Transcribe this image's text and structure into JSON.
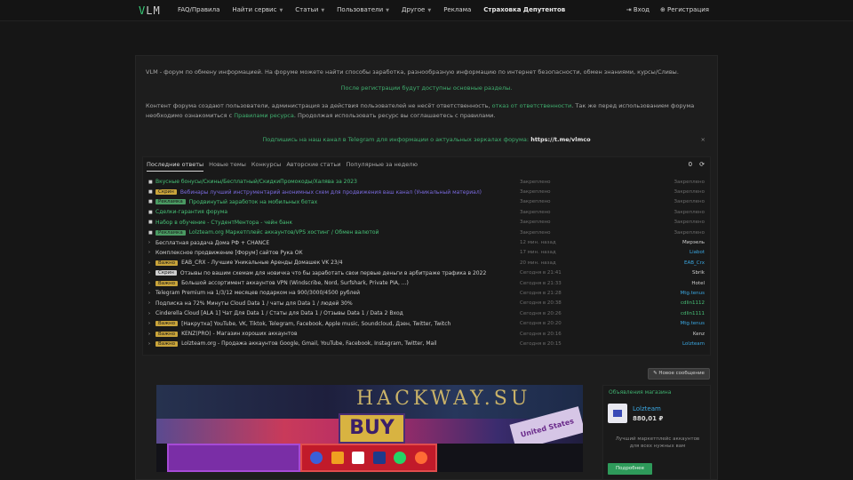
{
  "header": {
    "logo": "VLM",
    "nav": [
      {
        "label": "FAQ/Правила",
        "caret": false
      },
      {
        "label": "Найти сервис",
        "caret": true
      },
      {
        "label": "Статьи",
        "caret": true
      },
      {
        "label": "Пользователи",
        "caret": true
      },
      {
        "label": "Другое",
        "caret": true
      },
      {
        "label": "Реклама",
        "caret": false
      },
      {
        "label": "Страховка Депутентов",
        "caret": false
      }
    ],
    "login": "Вход",
    "register": "Регистрация"
  },
  "intro": {
    "text": "VLM - форум по обмену информацией. На форуме можете найти способы заработка, разнообразную информацию по интернет безопасности, обмен знаниями, курсы/Сливы.",
    "registration_note": "После регистрации будут доступны основные разделы.",
    "text2_a": "Контент форума создают пользователи, администрация за действия пользователей не несёт ответственность,",
    "text2_link": "отказ от ответственности",
    "text2_b": ". Так же перед использованием форума необходимо ознакомиться с",
    "text2_rules": "Правилами ресурса",
    "text2_c": ". Продолжая использовать ресурс вы соглашаетесь с правилами.",
    "telegram_text": "Подпишись на наш канал в Telegram для информации о актуальных зеркалах форума:",
    "telegram_link": "https://t.me/vlmco",
    "close": "×"
  },
  "threads": {
    "tabs": [
      "Последние ответы",
      "Новые темы",
      "Конкурсы",
      "Авторские статьи",
      "Популярные за неделю"
    ],
    "tools_count": "0",
    "rows": [
      {
        "tag": "",
        "tag_color": "",
        "title": "Вкусные бонусы/Скины/Бесплатный/СкидкиПромокоды/Халява за 2023",
        "color": "t-green",
        "meta": "Закреплено",
        "user": "Закреплено"
      },
      {
        "tag": "Скрин",
        "tag_color": "#c9a43a",
        "title": "Вебинары лучший инструментарий анонимных схем для продвижения ваш канал (Уникальный материал)",
        "color": "t-purple",
        "meta": "Закреплено",
        "user": "Закреплено"
      },
      {
        "tag": "Рекламка",
        "tag_color": "#4a9a62",
        "title": "Продвинутый заработок на мобильных ботах",
        "color": "t-green",
        "meta": "Закреплено",
        "user": "Закреплено"
      },
      {
        "tag": "",
        "tag_color": "",
        "title": "Сделки-гарантия форума",
        "color": "t-green",
        "meta": "Закреплено",
        "user": "Закреплено"
      },
      {
        "tag": "",
        "tag_color": "",
        "title": "Набор в обучение - СтудентМентора - чейн банк",
        "color": "t-green",
        "meta": "Закреплено",
        "user": "Закреплено"
      },
      {
        "tag": "Рекламка",
        "tag_color": "#4a9a62",
        "title": "Lolzteam.org Маркетплейс аккаунтов/VPS хостинг / Обмен валютой",
        "color": "t-green",
        "meta": "Закреплено",
        "user": "Закреплено"
      },
      {
        "tag": "",
        "tag_color": "",
        "title": "Бесплатная раздача Дома РФ + CHANCE",
        "color": "t-white",
        "meta": "12 мин. назад",
        "user": "Мирэель"
      },
      {
        "tag": "",
        "tag_color": "",
        "title": "Комплексное продвижение [Форум] сайтов Рука ОК",
        "color": "t-white",
        "meta": "17 мин. назад",
        "user": "Liabot"
      },
      {
        "tag": "Важно",
        "tag_color": "#c9a43a",
        "title": "EAB_CRX - Лучшие Уникальные Аренды Домашек VK 23/4",
        "color": "t-white",
        "meta": "20 мин. назад",
        "user": "EAB_Crx"
      },
      {
        "tag": "Скрин",
        "tag_color": "#cfcfcf",
        "title": "Отзывы по вашим схемам для новичка что бы заработать свои первые деньги в арбитраже трафика в 2022",
        "color": "t-white",
        "meta": "Сегодня в 21:41",
        "user": "Sbrik"
      },
      {
        "tag": "Важно",
        "tag_color": "#c9a43a",
        "title": "Большой ассортимент аккаунтов VPN (Windscribe, Nord, Surfshark, Private PIA, ...)",
        "color": "t-white",
        "meta": "Сегодня в 21:33",
        "user": "Hotel"
      },
      {
        "tag": "",
        "tag_color": "",
        "title": "Telegram Premium на 1/3/12 месяцев подарком на 900/3000/4500 рублей",
        "color": "t-white",
        "meta": "Сегодня в 21:28",
        "user": "Mtg.tenus"
      },
      {
        "tag": "",
        "tag_color": "",
        "title": "Подписка на 72% Минуты Cloud Data 1 / чаты для Data 1 / людей 30%",
        "color": "t-white",
        "meta": "Сегодня в 20:38",
        "user": "cdlin1112"
      },
      {
        "tag": "",
        "tag_color": "",
        "title": "Cinderella Cloud [ALA 1] Чат Для Data 1 / Статы для Data 1 / Отзывы Data 1 / Data 2 Вход",
        "color": "t-white",
        "meta": "Сегодня в 20:26",
        "user": "cdlin1111"
      },
      {
        "tag": "Важно",
        "tag_color": "#c9a43a",
        "title": "[Накрутка] YouTube, VK, Tiktok, Telegram, Facebook, Apple music, Soundcloud, Дзен, Twitter, Twitch",
        "color": "t-white",
        "meta": "Сегодня в 20:20",
        "user": "Mtg.tenus"
      },
      {
        "tag": "Важно",
        "tag_color": "#c9a43a",
        "title": "KENZ(PRO) - Магазин хороших аккаунтов",
        "color": "t-white",
        "meta": "Сегодня в 20:16",
        "user": "Kenz"
      },
      {
        "tag": "Важно",
        "tag_color": "#c9a43a",
        "title": "Lolzteam.org - Продажа аккаунтов Google, Gmail, YouTube, Facebook, Instagram, Twitter, Mail",
        "color": "t-white",
        "meta": "Сегодня в 20:15",
        "user": "Lolzteam"
      }
    ]
  },
  "add_topic_button": "Новое сообщение",
  "banner": {
    "title": "HACKWAY.SU",
    "buy_text": "BUY",
    "united_text": "United States"
  },
  "sidebar_ad": {
    "heading": "Объявления магазина",
    "name": "Lolzteam",
    "price": "880,01 ₽",
    "description": "Лучший маркетплейс аккаунтов для всех нужных вам",
    "button": "Подробнее"
  }
}
